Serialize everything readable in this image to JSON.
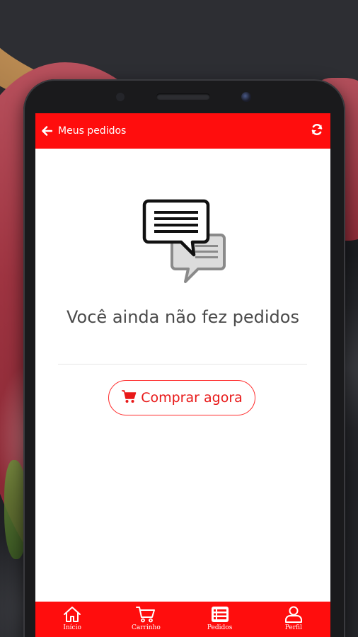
{
  "appbar": {
    "title": "Meus pedidos",
    "back_icon": "arrow-left-icon",
    "refresh_icon": "refresh-icon"
  },
  "empty_state": {
    "icon": "chat-bubbles-icon",
    "message": "Você ainda não fez pedidos",
    "button_label": "Comprar agora",
    "button_icon": "cart-icon"
  },
  "bottom_nav": {
    "items": [
      {
        "label": "Início",
        "icon": "home-icon"
      },
      {
        "label": "Carrinho",
        "icon": "cart-icon"
      },
      {
        "label": "Pedidos",
        "icon": "orders-list-icon"
      },
      {
        "label": "Perfil",
        "icon": "user-icon"
      }
    ]
  },
  "colors": {
    "primary": "#ff0d0d",
    "button_text": "#e81818",
    "message_text": "#4a4a4a",
    "screen_background": "#ffffff"
  }
}
